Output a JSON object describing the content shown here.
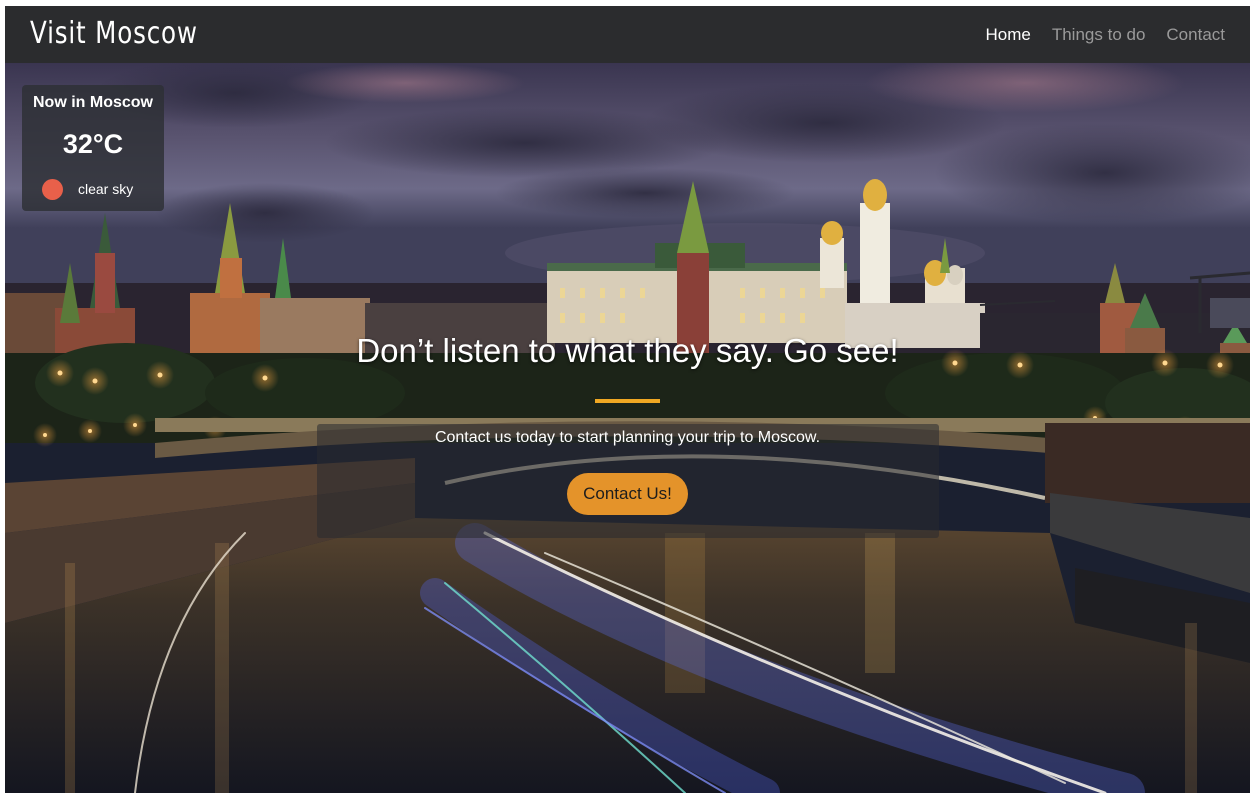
{
  "brand": "Visit Moscow",
  "nav": {
    "items": [
      {
        "label": "Home",
        "active": true
      },
      {
        "label": "Things to do",
        "active": false
      },
      {
        "label": "Contact",
        "active": false
      }
    ]
  },
  "weather": {
    "title": "Now in Moscow",
    "temperature": "32°C",
    "description": "clear sky",
    "icon": "sun-icon",
    "icon_color": "#e8604a"
  },
  "hero": {
    "headline": "Don’t listen to what they say. Go see!",
    "subtitle": "Contact us today to start planning your trip to Moscow.",
    "cta_label": "Contact Us!"
  },
  "colors": {
    "navbar": "#2b2c2e",
    "accent": "#f0a823",
    "button": "#e4932a"
  }
}
